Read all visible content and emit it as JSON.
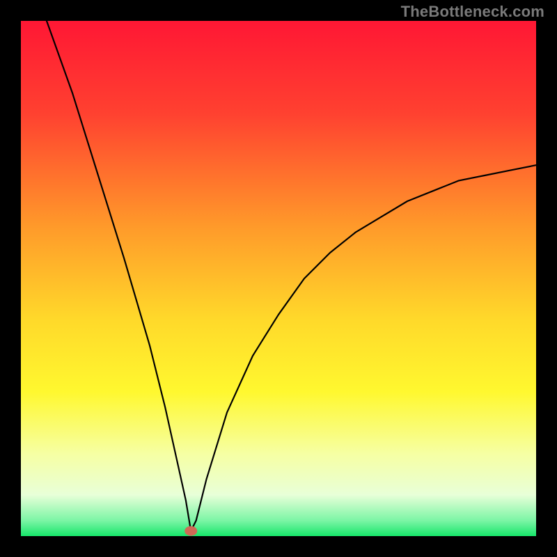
{
  "watermark": "TheBottleneck.com",
  "chart_data": {
    "type": "line",
    "title": "",
    "xlabel": "",
    "ylabel": "",
    "xlim": [
      0,
      100
    ],
    "ylim": [
      0,
      100
    ],
    "optimum_x": 33,
    "green_band_y": 3,
    "curve_description": "V-shaped bottleneck curve. Y (bottleneck %) drops from ~100 at x=0 to ~0 at x≈33 (optimum marked by red dot), then rises back toward ~72 at x=100. Vertical gradient background: green at bottom through yellow/orange to red at top.",
    "series": [
      {
        "name": "bottleneck",
        "x": [
          5,
          10,
          15,
          20,
          25,
          28,
          30,
          32,
          33,
          34,
          36,
          40,
          45,
          50,
          55,
          60,
          65,
          70,
          75,
          80,
          85,
          90,
          95,
          100
        ],
        "values": [
          100,
          86,
          70,
          54,
          37,
          25,
          16,
          7,
          1,
          3,
          11,
          24,
          35,
          43,
          50,
          55,
          59,
          62,
          65,
          67,
          69,
          70,
          71,
          72
        ]
      }
    ],
    "gradient_stops": [
      {
        "pct": 0,
        "color": "#ff1734"
      },
      {
        "pct": 18,
        "color": "#ff4130"
      },
      {
        "pct": 40,
        "color": "#ff9a2a"
      },
      {
        "pct": 58,
        "color": "#ffd92a"
      },
      {
        "pct": 72,
        "color": "#fff82f"
      },
      {
        "pct": 84,
        "color": "#f6ffa3"
      },
      {
        "pct": 92,
        "color": "#e8ffd8"
      },
      {
        "pct": 97,
        "color": "#7bf5a5"
      },
      {
        "pct": 100,
        "color": "#17e66a"
      }
    ],
    "marker": {
      "x": 33,
      "y": 1,
      "color": "#cf6a56"
    }
  },
  "frame": {
    "outer_margin": 0,
    "plot_inset": 30,
    "border_color": "#000000"
  }
}
